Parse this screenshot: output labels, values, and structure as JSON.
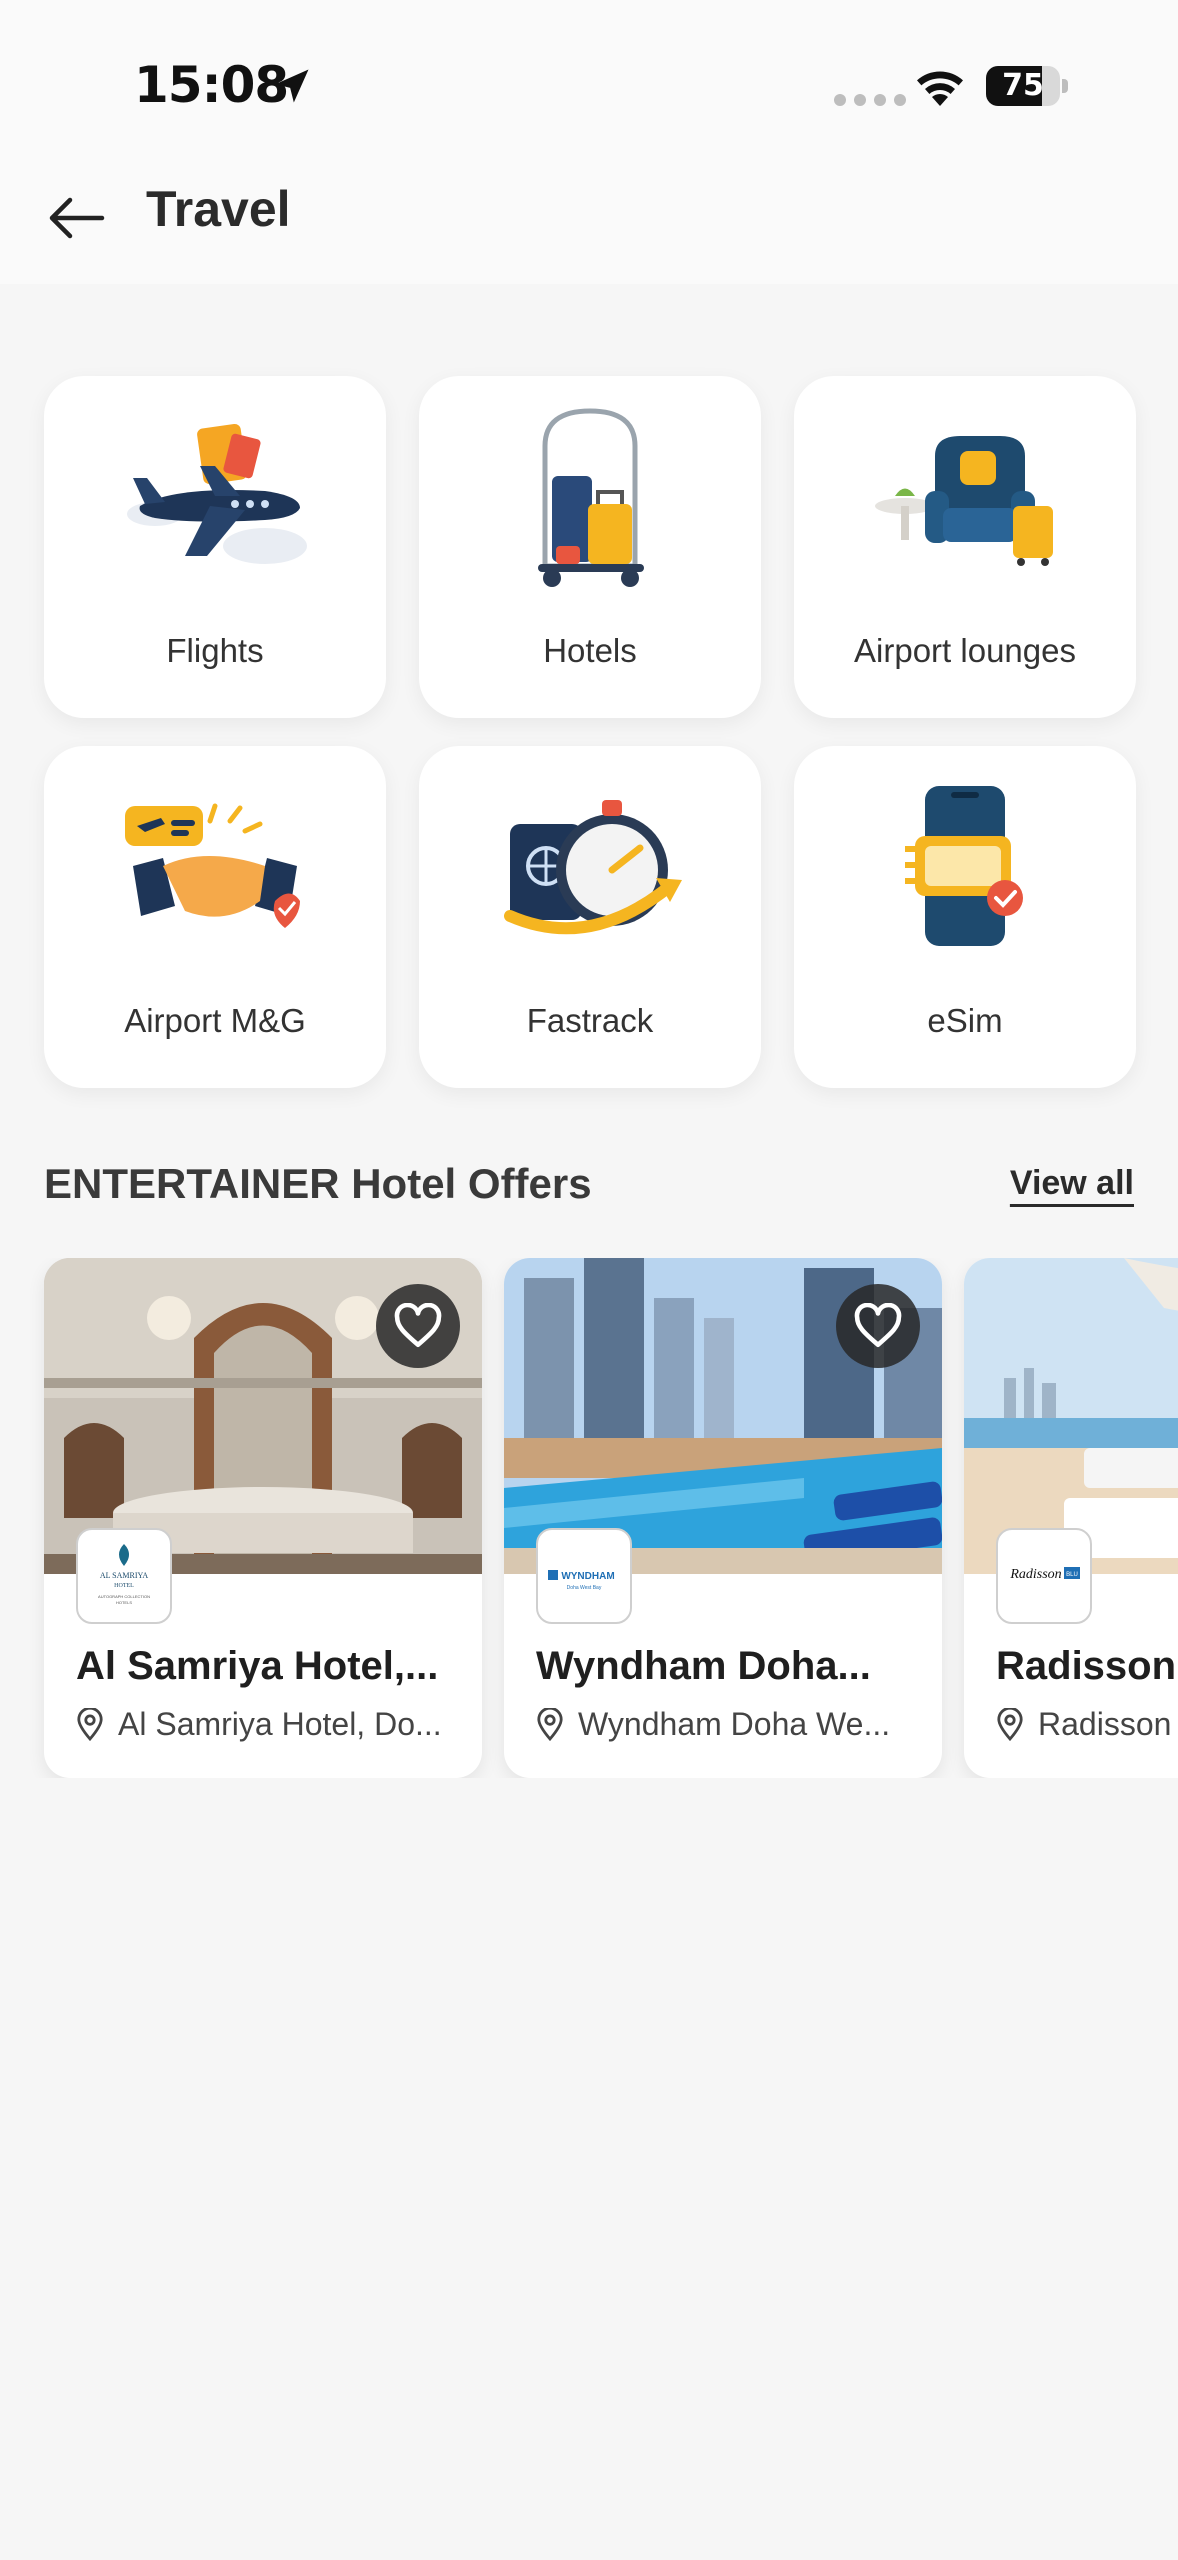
{
  "status_bar": {
    "time": "15:08",
    "battery": "75",
    "battery_level": 0.75
  },
  "header": {
    "title": "Travel",
    "back_icon": "arrow-left-icon"
  },
  "categories": [
    {
      "label": "Flights",
      "icon": "airplane-icon"
    },
    {
      "label": "Hotels",
      "icon": "luggage-cart-icon"
    },
    {
      "label": "Airport lounges",
      "icon": "armchair-icon"
    },
    {
      "label": "Airport M&G",
      "icon": "handshake-icon"
    },
    {
      "label": "Fastrack",
      "icon": "stopwatch-passport-icon"
    },
    {
      "label": "eSim",
      "icon": "phone-sim-icon"
    }
  ],
  "offers": {
    "title": "ENTERTAINER Hotel Offers",
    "view_all": "View all",
    "items": [
      {
        "name": "Al Samriya Hotel,...",
        "location": "Al Samriya Hotel, Do...",
        "logo_lines": [
          "AL SAMRIYA",
          "HOTEL",
          "AUTOGRAPH COLLECTION",
          "HOTELS"
        ]
      },
      {
        "name": "Wyndham Doha...",
        "location": "Wyndham Doha We...",
        "logo_lines": [
          "WYNDHAM",
          "Doha West Bay"
        ]
      },
      {
        "name": "Radisson",
        "location": "Radisson",
        "logo_lines": [
          "Radisson",
          "BLU"
        ]
      }
    ]
  },
  "colors": {
    "accent_blue": "#1f6fb5",
    "navy": "#223a5e",
    "gold": "#f5b520",
    "card_bg": "#ffffff",
    "page_bg": "#f6f6f6"
  }
}
